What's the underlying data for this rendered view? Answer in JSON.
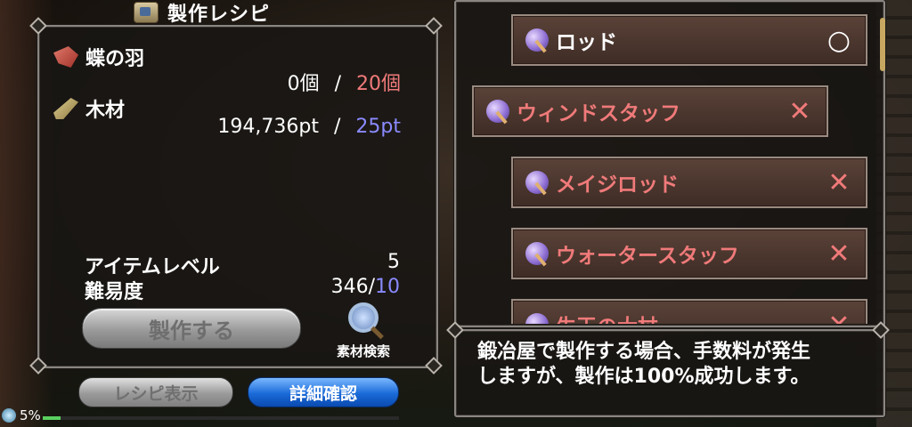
{
  "title": "製作レシピ",
  "materials": [
    {
      "name": "蝶の羽",
      "have": "0個",
      "separator": "/",
      "need": "20個",
      "icon": "butterfly-wing-icon"
    },
    {
      "name": "木材",
      "have": "194,736pt",
      "separator": "/",
      "need": "25pt",
      "icon": "wood-icon"
    }
  ],
  "stats": {
    "item_level_label": "アイテムレベル",
    "item_level_value": "5",
    "difficulty_label": "難易度",
    "difficulty_value": "346",
    "difficulty_separator": "/",
    "difficulty_max": "10"
  },
  "buttons": {
    "craft": "製作する",
    "material_search": "素材検索",
    "recipe_display": "レシピ表示",
    "detail_confirm": "詳細確認"
  },
  "recipes": [
    {
      "name": "ロッド",
      "mark": "○",
      "craftable": true
    },
    {
      "name": "ウィンドスタッフ",
      "mark": "✕",
      "craftable": false
    },
    {
      "name": "メイジロッド",
      "mark": "✕",
      "craftable": false
    },
    {
      "name": "ウォータースタッフ",
      "mark": "✕",
      "craftable": false
    },
    {
      "name": "生王の大杖",
      "mark": "✕",
      "craftable": false
    }
  ],
  "message": {
    "line1": "鍛冶屋で製作する場合、手数料が発生",
    "line2": "しますが、製作は100%成功します。"
  },
  "status": {
    "percent": "5%",
    "progress": 0.05
  },
  "colors": {
    "shortage": "#f07a7a",
    "limit": "#8a8aff",
    "detail_button": "#1a6ad8"
  }
}
